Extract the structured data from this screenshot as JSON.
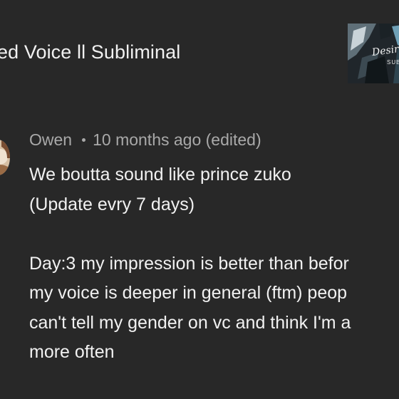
{
  "video": {
    "title": "ed Voice ll Subliminal",
    "thumbnail": {
      "text_line1": "Desire",
      "text_line2": "SUBL"
    }
  },
  "comment": {
    "author": "Owen",
    "time": "10 months ago (edited)",
    "lines_top": [
      "We boutta sound like prince zuko",
      "(Update evry 7 days)"
    ],
    "lines_bottom": [
      "Day:3 my impression is better than befor",
      "my voice is deeper in general (ftm) peop",
      "can't tell my gender on vc and think I'm a",
      "more often"
    ]
  },
  "colors": {
    "background": "#282828",
    "primary_text": "#f1f1f1",
    "secondary_text": "#a9a9a9"
  }
}
